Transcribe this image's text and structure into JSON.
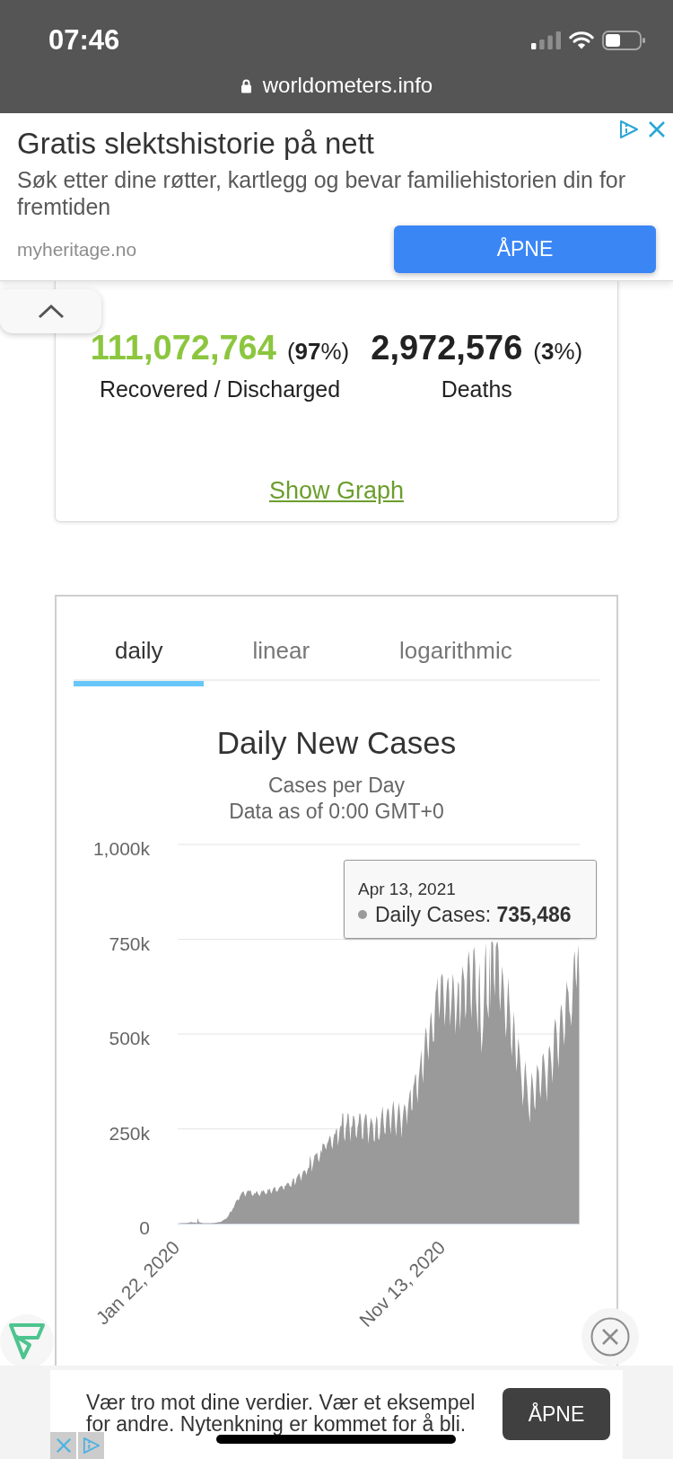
{
  "status_bar": {
    "time": "07:46"
  },
  "address_bar": {
    "url": "worldometers.info"
  },
  "top_ad": {
    "title": "Gratis slektshistorie på nett",
    "description": "Søk etter dine røtter, kartlegg og bevar familiehistorien din for fremtiden",
    "domain": "myheritage.no",
    "button": "ÅPNE"
  },
  "stats_card": {
    "stats": [
      {
        "value": "111,072,764",
        "percent": "(**97**%)",
        "label": "Recovered / Discharged",
        "color": "#8cc63f"
      },
      {
        "value": "2,972,576",
        "percent": "(**3**%)",
        "label": "Deaths",
        "color": "#222222"
      }
    ],
    "link": "Show Graph"
  },
  "chart_card": {
    "tabs": [
      {
        "label": "daily",
        "selected": true
      },
      {
        "label": "linear",
        "selected": false
      },
      {
        "label": "logarithmic",
        "selected": false
      }
    ],
    "subtitles": [
      "Cases per Day",
      "Data as of 0:00 GMT+0"
    ],
    "tooltip": {
      "date": "Apr 13, 2021",
      "text": "Daily Cases: **735,486**"
    },
    "chart_data": {
      "type": "area",
      "title": "Daily New Cases",
      "grid": true,
      "ylim": [
        0,
        1000
      ],
      "yticks": [
        {
          "value": 0,
          "label": "0"
        },
        {
          "value": 250,
          "label": "250k"
        },
        {
          "value": 500,
          "label": "500k"
        },
        {
          "value": 750,
          "label": "750k"
        },
        {
          "value": 1000,
          "label": "1,000k"
        }
      ],
      "categories": [
        "Jan 22, 2020",
        null,
        null,
        null,
        null,
        null,
        null,
        null,
        null,
        null,
        null,
        null,
        null,
        null,
        null,
        null,
        null,
        null,
        null,
        null,
        null,
        null,
        null,
        null,
        null,
        null,
        null,
        null,
        null,
        null,
        null,
        null,
        null,
        null,
        null,
        null,
        null,
        null,
        null,
        null,
        null,
        null,
        null,
        null,
        null,
        null,
        null,
        null,
        null,
        null,
        null,
        null,
        null,
        null,
        null,
        null,
        null,
        null,
        null,
        null,
        null,
        null,
        null,
        null,
        null,
        null,
        null,
        null,
        null,
        null,
        null,
        null,
        null,
        null,
        null,
        null,
        null,
        null,
        null,
        null,
        null,
        null,
        null,
        null,
        null,
        null,
        null,
        null,
        null,
        null,
        null,
        null,
        null,
        null,
        null,
        null,
        null,
        null,
        null,
        null,
        null,
        null,
        null,
        null,
        null,
        null,
        null,
        null,
        null,
        null,
        null,
        null,
        null,
        null,
        null,
        null,
        null,
        null,
        null,
        null,
        null,
        null,
        null,
        null,
        null,
        null,
        null,
        null,
        null,
        null,
        null,
        null,
        null,
        null,
        null,
        null,
        null,
        null,
        null,
        null,
        null,
        null,
        null,
        null,
        null,
        null,
        null,
        null,
        null,
        null,
        null,
        null,
        null,
        null,
        null,
        null,
        null,
        null,
        null,
        null,
        null,
        null,
        null,
        null,
        null,
        null,
        null,
        null,
        null,
        null,
        null,
        null,
        null,
        null,
        null,
        null,
        null,
        null,
        null,
        null,
        null,
        null,
        null,
        null,
        null,
        null,
        null,
        null,
        null,
        null,
        null,
        null,
        null,
        null,
        null,
        null,
        null,
        null,
        null,
        null,
        null,
        null,
        null,
        null,
        null,
        null,
        null,
        null,
        null,
        null,
        null,
        null,
        null,
        null,
        null,
        null,
        null,
        null,
        null,
        null,
        null,
        null,
        null,
        null,
        null,
        null,
        null,
        null,
        null,
        null,
        null,
        null,
        null,
        null,
        null,
        null,
        null,
        null,
        null,
        null,
        null,
        null,
        null,
        null,
        null,
        null,
        null,
        null,
        null,
        null,
        null,
        null,
        null,
        null,
        null,
        null,
        null,
        null,
        null,
        null,
        null,
        null,
        null,
        null,
        null,
        null,
        null,
        null,
        null,
        null,
        null,
        null,
        null,
        null,
        null,
        null,
        null,
        null,
        null,
        null,
        null,
        null,
        null,
        null,
        null,
        null,
        null,
        null,
        null,
        null,
        null,
        null,
        null,
        null,
        null,
        null,
        "Nov 13, 2020",
        null,
        null,
        null,
        null,
        null,
        null,
        null,
        null,
        null,
        null,
        null,
        null,
        null,
        null,
        null,
        null,
        null,
        null,
        null,
        null,
        null,
        null,
        null,
        null,
        null,
        null,
        null,
        null,
        null,
        null,
        null,
        null,
        null,
        null,
        null,
        null,
        null,
        null,
        null,
        null,
        null,
        null,
        null,
        null,
        null,
        null,
        null,
        null,
        null,
        null,
        null,
        null,
        null,
        null,
        null,
        null,
        null,
        null,
        null,
        null,
        null,
        null,
        null,
        null,
        null,
        null,
        null,
        null,
        null,
        null,
        null,
        null,
        null,
        null,
        null,
        null,
        null,
        null,
        null,
        null,
        null,
        null,
        null,
        null,
        null,
        null,
        null,
        null,
        null,
        null,
        null,
        null,
        null,
        null,
        null,
        null,
        null,
        null,
        null,
        null,
        null,
        null,
        null,
        null,
        null,
        null,
        null,
        null,
        null,
        null,
        null,
        null,
        null,
        null,
        null,
        null,
        null,
        null,
        null,
        null,
        null,
        null,
        null,
        null,
        null,
        null,
        null,
        null,
        null,
        null,
        null,
        null,
        null,
        null,
        null,
        null,
        null,
        null,
        null,
        null,
        null,
        null,
        null,
        null,
        null,
        null,
        null,
        null,
        null,
        null,
        null
      ],
      "values": [
        1,
        0,
        1,
        1,
        1,
        1,
        2,
        1,
        2,
        2,
        2,
        2,
        3,
        3,
        4,
        4,
        3,
        3,
        3,
        3,
        2,
        2,
        15,
        5,
        3,
        3,
        2,
        2,
        1,
        1,
        1,
        1,
        1,
        1,
        1,
        1,
        1,
        1,
        2,
        2,
        2,
        2,
        3,
        3,
        3,
        4,
        4,
        4,
        5,
        7,
        8,
        10,
        12,
        12,
        14,
        17,
        20,
        26,
        32,
        31,
        34,
        40,
        42,
        50,
        56,
        61,
        64,
        61,
        64,
        73,
        77,
        82,
        84,
        85,
        77,
        71,
        80,
        85,
        89,
        85,
        87,
        87,
        77,
        73,
        75,
        82,
        78,
        84,
        86,
        79,
        76,
        72,
        80,
        87,
        84,
        89,
        85,
        80,
        77,
        80,
        91,
        88,
        93,
        84,
        79,
        86,
        93,
        95,
        98,
        86,
        84,
        86,
        92,
        96,
        98,
        100,
        99,
        93,
        89,
        100,
        100,
        105,
        108,
        107,
        102,
        98,
        97,
        110,
        118,
        121,
        102,
        107,
        120,
        125,
        130,
        133,
        124,
        112,
        126,
        136,
        140,
        141,
        137,
        128,
        140,
        147,
        148,
        180,
        167,
        137,
        152,
        165,
        180,
        182,
        185,
        187,
        170,
        162,
        176,
        195,
        186,
        212,
        210,
        209,
        200,
        195,
        211,
        215,
        223,
        232,
        227,
        205,
        196,
        222,
        237,
        236,
        248,
        250,
        205,
        224,
        247,
        259,
        256,
        290,
        290,
        227,
        217,
        255,
        266,
        292,
        288,
        255,
        215,
        255,
        257,
        285,
        283,
        270,
        232,
        225,
        255,
        265,
        290,
        290,
        270,
        225,
        222,
        265,
        280,
        290,
        285,
        250,
        210,
        240,
        265,
        280,
        270,
        260,
        220,
        215,
        260,
        285,
        275,
        225,
        220,
        240,
        275,
        295,
        310,
        265,
        240,
        235,
        280,
        300,
        305,
        295,
        260,
        235,
        280,
        310,
        325,
        295,
        255,
        230,
        270,
        300,
        320,
        300,
        265,
        225,
        270,
        295,
        315,
        310,
        295,
        260,
        300,
        325,
        345,
        355,
        300,
        300,
        360,
        370,
        390,
        395,
        340,
        320,
        380,
        405,
        430,
        460,
        400,
        370,
        435,
        490,
        520,
        500,
        460,
        430,
        500,
        540,
        560,
        520,
        480,
        480,
        560,
        610,
        620,
        650,
        590,
        540,
        580,
        650,
        660,
        650,
        590,
        520,
        560,
        610,
        640,
        650,
        610,
        520,
        560,
        600,
        660,
        640,
        590,
        500,
        540,
        590,
        640,
        630,
        510,
        560,
        650,
        680,
        660,
        640,
        540,
        560,
        650,
        700,
        720,
        680,
        580,
        540,
        640,
        720,
        730,
        690,
        590,
        550,
        500,
        640,
        690,
        530,
        450,
        480,
        520,
        610,
        700,
        740,
        580,
        560,
        540,
        730,
        565,
        742,
        745,
        738,
        640,
        600,
        730,
        740,
        744,
        720,
        600,
        560,
        620,
        680,
        655,
        620,
        560,
        490,
        520,
        600,
        650,
        590,
        550,
        470,
        440,
        510,
        560,
        520,
        450,
        400,
        430,
        490,
        470,
        440,
        400,
        360,
        310,
        340,
        400,
        430,
        390,
        360,
        320,
        290,
        265,
        350,
        400,
        380,
        350,
        310,
        300,
        370,
        420,
        410,
        400,
        350,
        330,
        380,
        440,
        450,
        430,
        400,
        360,
        320,
        400,
        460,
        470,
        450,
        420,
        370,
        420,
        510,
        540,
        530,
        500,
        440,
        410,
        500,
        560,
        580,
        560,
        520,
        470,
        500,
        590,
        640,
        620,
        610,
        560,
        550,
        520,
        560,
        640,
        700,
        720,
        650,
        620,
        700,
        735,
        645
      ]
    }
  },
  "bottom_ad": {
    "text": "Vær tro mot dine verdier. Vær et eksempel for andre. Nytenkning er kommet for å bli.",
    "button": "ÅPNE"
  }
}
